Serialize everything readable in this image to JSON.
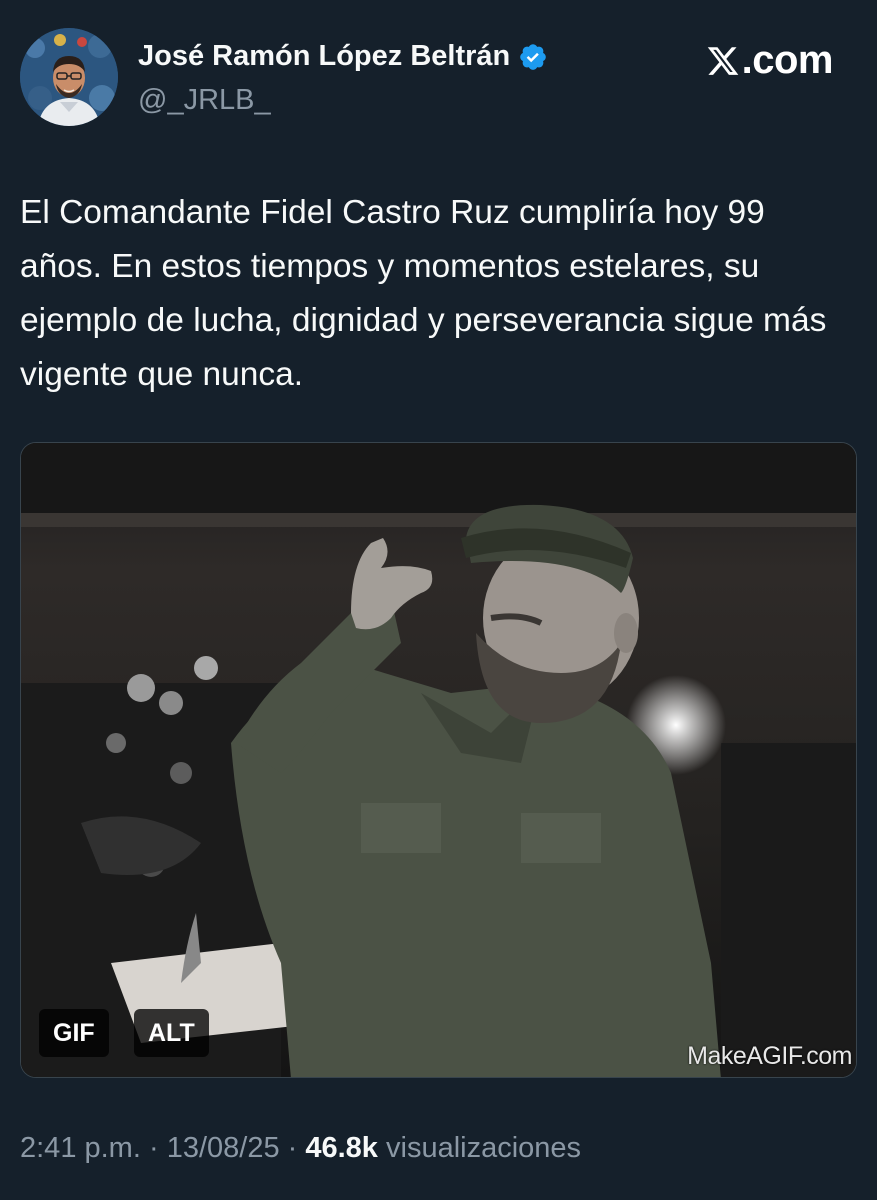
{
  "author": {
    "name": "José Ramón López Beltrán",
    "handle": "@_JRLB_",
    "verified": true,
    "verified_color": "#1d9bf0"
  },
  "brand": {
    "label": ".com",
    "icon": "x-logo-icon"
  },
  "tweet": {
    "text": "El Comandante Fidel Castro Ruz cumpliría hoy 99 años. En estos tiempos y momentos estelares, su ejemplo de lucha, dignidad y perseverancia sigue más vigente que nunca."
  },
  "media": {
    "gif_badge": "GIF",
    "alt_badge": "ALT",
    "watermark": "MakeAGIF.com"
  },
  "meta": {
    "time": "2:41 p.m.",
    "separator1": " · ",
    "date": "13/08/25",
    "separator2": " · ",
    "views_count": "46.8k",
    "views_label": " visualizaciones"
  },
  "colors": {
    "background": "#15202b",
    "text": "#f7f9f9",
    "muted": "#8b98a5",
    "accent": "#1d9bf0"
  }
}
